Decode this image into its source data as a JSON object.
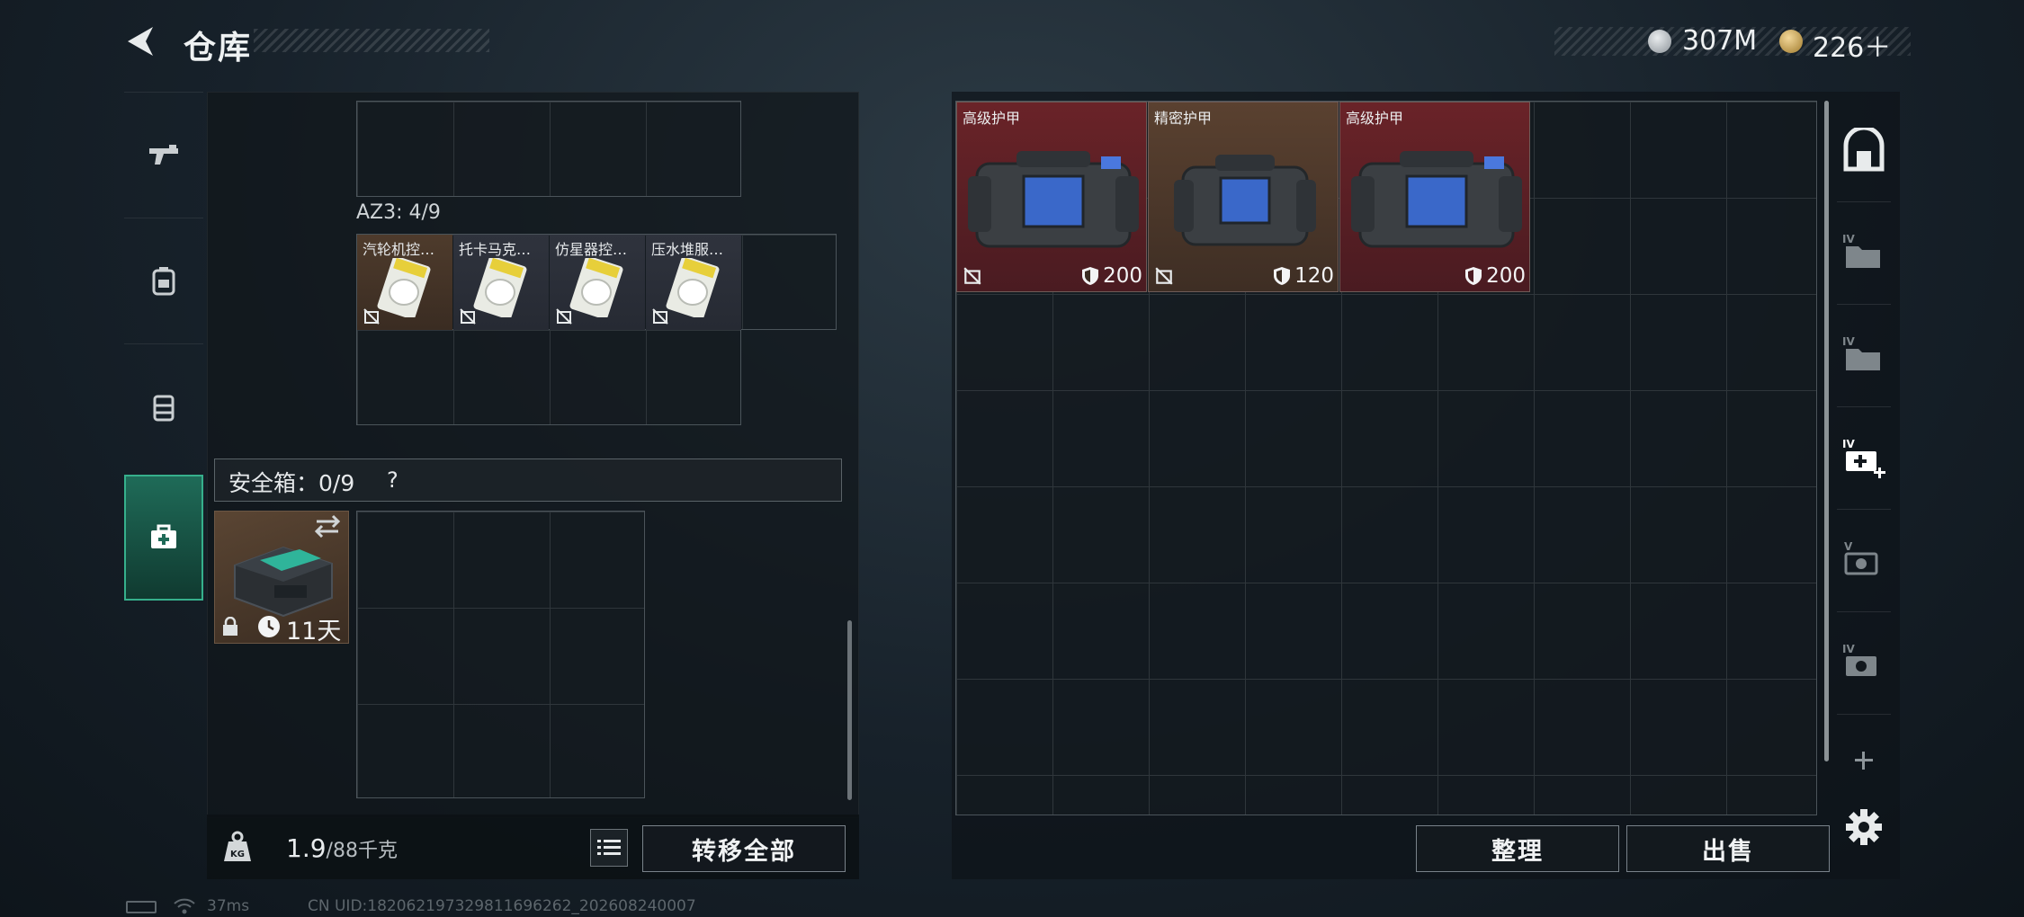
{
  "header": {
    "title": "仓库",
    "currencies": [
      {
        "icon": "silver-coin-icon",
        "value": "307M"
      },
      {
        "icon": "gold-coin-icon",
        "value": "226＋"
      }
    ]
  },
  "left_tabs": [
    "pistol-icon",
    "backpack-icon",
    "rig-icon",
    "medkit-icon"
  ],
  "container": {
    "az3_label": "AZ3: 4/9",
    "items": [
      {
        "name": "汽轮机控…",
        "nosell": true
      },
      {
        "name": "托卡马克…",
        "nosell": true
      },
      {
        "name": "仿星器控…",
        "nosell": true
      },
      {
        "name": "压水堆服…",
        "nosell": true
      }
    ],
    "safe_box_label": "安全箱：0/9",
    "help": "?",
    "safe_box_item": {
      "days": "11天"
    }
  },
  "weight": {
    "current": "1.9",
    "max": "/88千克"
  },
  "buttons": {
    "transfer_all": "转移全部",
    "sort": "整理",
    "sell": "出售"
  },
  "storage": {
    "items": [
      {
        "name": "高级护甲",
        "durability": "200",
        "rarity": "red"
      },
      {
        "name": "精密护甲",
        "durability": "120",
        "rarity": "brown"
      },
      {
        "name": "高级护甲",
        "durability": "200",
        "rarity": "red"
      }
    ]
  },
  "right_tabs": [
    "vault-icon",
    "folder-iv-icon",
    "folder-iv-icon",
    "add-iv-icon",
    "v-camera-icon",
    "iv-camera-icon"
  ],
  "status_bar": {
    "ping": "37ms",
    "uid": "CN UID:1820621973298116962​62_202608240007"
  },
  "colors": {
    "accent": "#36b08c",
    "rarity_red": "#6a2328",
    "rarity_brown": "#5a4130"
  }
}
